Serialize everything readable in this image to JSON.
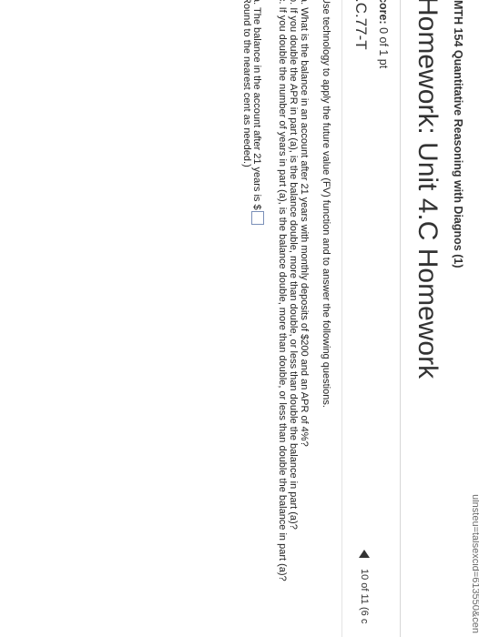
{
  "browser": {
    "url_fragment": "ulnsteu=talsexcid=613550&cen"
  },
  "header": {
    "course": "MTH 154 Quantitative Reasoning with Diagnos (1)"
  },
  "assignment": {
    "title": "Homework: Unit 4.C Homework"
  },
  "score": {
    "label": "core:",
    "value": "0 of 1 pt"
  },
  "question": {
    "id": ".C.77-T",
    "position": "10 of 11 (6 c",
    "intro": "Use technology to apply the future value (FV) function and to answer the following questions.",
    "parts": [
      "a. What is the balance in an account after 21 years with monthly deposits of $200 and an APR of 4%?",
      "b. If you double the APR in part (a), is the balance double, more than double, or less than double the balance in part (a)?",
      "c. If you double the number of years in part (a), is the balance double, more than double, or less than double the balance in part (a)?"
    ],
    "answer_prompt": "a. The balance in the account after 21 years is $",
    "round_note": "Round to the nearest cent as needed.)"
  }
}
